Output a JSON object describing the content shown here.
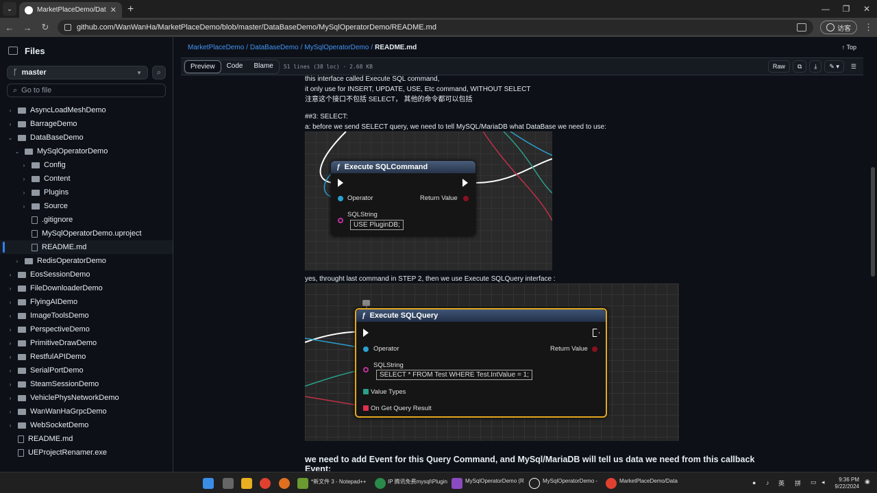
{
  "browser": {
    "tab_title": "MarketPlaceDemo/DataBaseDe",
    "url": "github.com/WanWanHa/MarketPlaceDemo/blob/master/DataBaseDemo/MySqlOperatorDemo/README.md",
    "profile_label": "访客"
  },
  "sidebar": {
    "title": "Files",
    "branch": "master",
    "goto_placeholder": "Go to file",
    "items": [
      {
        "label": "AsyncLoadMeshDemo",
        "type": "folder",
        "depth": 0,
        "expanded": false
      },
      {
        "label": "BarrageDemo",
        "type": "folder",
        "depth": 0,
        "expanded": false
      },
      {
        "label": "DataBaseDemo",
        "type": "folder",
        "depth": 0,
        "expanded": true
      },
      {
        "label": "MySqlOperatorDemo",
        "type": "folder",
        "depth": 1,
        "expanded": true
      },
      {
        "label": "Config",
        "type": "folder",
        "depth": 2,
        "expanded": false
      },
      {
        "label": "Content",
        "type": "folder",
        "depth": 2,
        "expanded": false
      },
      {
        "label": "Plugins",
        "type": "folder",
        "depth": 2,
        "expanded": false
      },
      {
        "label": "Source",
        "type": "folder",
        "depth": 2,
        "expanded": false
      },
      {
        "label": ".gitignore",
        "type": "file",
        "depth": 2
      },
      {
        "label": "MySqlOperatorDemo.uproject",
        "type": "file",
        "depth": 2
      },
      {
        "label": "README.md",
        "type": "file",
        "depth": 2,
        "selected": true
      },
      {
        "label": "RedisOperatorDemo",
        "type": "folder",
        "depth": 1,
        "expanded": false
      },
      {
        "label": "EosSessionDemo",
        "type": "folder",
        "depth": 0,
        "expanded": false
      },
      {
        "label": "FileDownloaderDemo",
        "type": "folder",
        "depth": 0,
        "expanded": false
      },
      {
        "label": "FlyingAIDemo",
        "type": "folder",
        "depth": 0,
        "expanded": false
      },
      {
        "label": "ImageToolsDemo",
        "type": "folder",
        "depth": 0,
        "expanded": false
      },
      {
        "label": "PerspectiveDemo",
        "type": "folder",
        "depth": 0,
        "expanded": false
      },
      {
        "label": "PrimitiveDrawDemo",
        "type": "folder",
        "depth": 0,
        "expanded": false
      },
      {
        "label": "RestfulAPIDemo",
        "type": "folder",
        "depth": 0,
        "expanded": false
      },
      {
        "label": "SerialPortDemo",
        "type": "folder",
        "depth": 0,
        "expanded": false
      },
      {
        "label": "SteamSessionDemo",
        "type": "folder",
        "depth": 0,
        "expanded": false
      },
      {
        "label": "VehiclePhysNetworkDemo",
        "type": "folder",
        "depth": 0,
        "expanded": false
      },
      {
        "label": "WanWanHaGrpcDemo",
        "type": "folder",
        "depth": 0,
        "expanded": false
      },
      {
        "label": "WebSocketDemo",
        "type": "folder",
        "depth": 0,
        "expanded": false
      },
      {
        "label": "README.md",
        "type": "file",
        "depth": 0
      },
      {
        "label": "UEProjectRenamer.exe",
        "type": "file",
        "depth": 0
      }
    ]
  },
  "breadcrumb": {
    "parts": [
      "MarketPlaceDemo",
      "DataBaseDemo",
      "MySqlOperatorDemo"
    ],
    "current": "README.md",
    "top_label": "Top"
  },
  "file_toolbar": {
    "tabs": [
      "Preview",
      "Code",
      "Blame"
    ],
    "meta": "51 lines (38 loc) · 2.68 KB",
    "raw_label": "Raw"
  },
  "content": {
    "lines": [
      "this interface called Execute SQL command,",
      "it only use for INSERT, UPDATE, USE, Etc command, WITHOUT SELECT",
      "注意这个接口不包括 SELECT， 其他的命令都可以包括"
    ],
    "step3_heading": "##3: SELECT:",
    "step3_text": "a: before we send SELECT query, we need to tell MySQL/MariaDB what DataBase we need to use:",
    "bp1": {
      "title": "Execute SQLCommand",
      "operator": "Operator",
      "return": "Return Value",
      "sqlstring": "SQLString",
      "sql_value": "USE PluginDB;"
    },
    "mid_text": "yes, throught last command in STEP 2, then we use Execute SQLQuery interface :",
    "bp2": {
      "title": "Execute SQLQuery",
      "operator": "Operator",
      "return": "Return Value",
      "sqlstring": "SQLString",
      "sql_value": "SELECT * FROM Test WHERE Test.IntValue = 1;",
      "value_types": "Value Types",
      "on_result": "On Get Query Result"
    },
    "bottom_heading": "we need to add Event for this Query Command, and MySql/MariaDB will tell us data we need from this callback",
    "bottom_heading2": "Event:"
  },
  "taskbar": {
    "apps": [
      "*新文件 3 - Notepad++",
      "IP 腾讯免费mysql\\Plugin",
      "MySqlOperatorDemo (R",
      "MySqlOperatorDemo - ",
      "MarketPlaceDemo/Data"
    ],
    "ime": "英",
    "ime2": "拼",
    "time": "9:36 PM",
    "date": "9/22/2024"
  }
}
